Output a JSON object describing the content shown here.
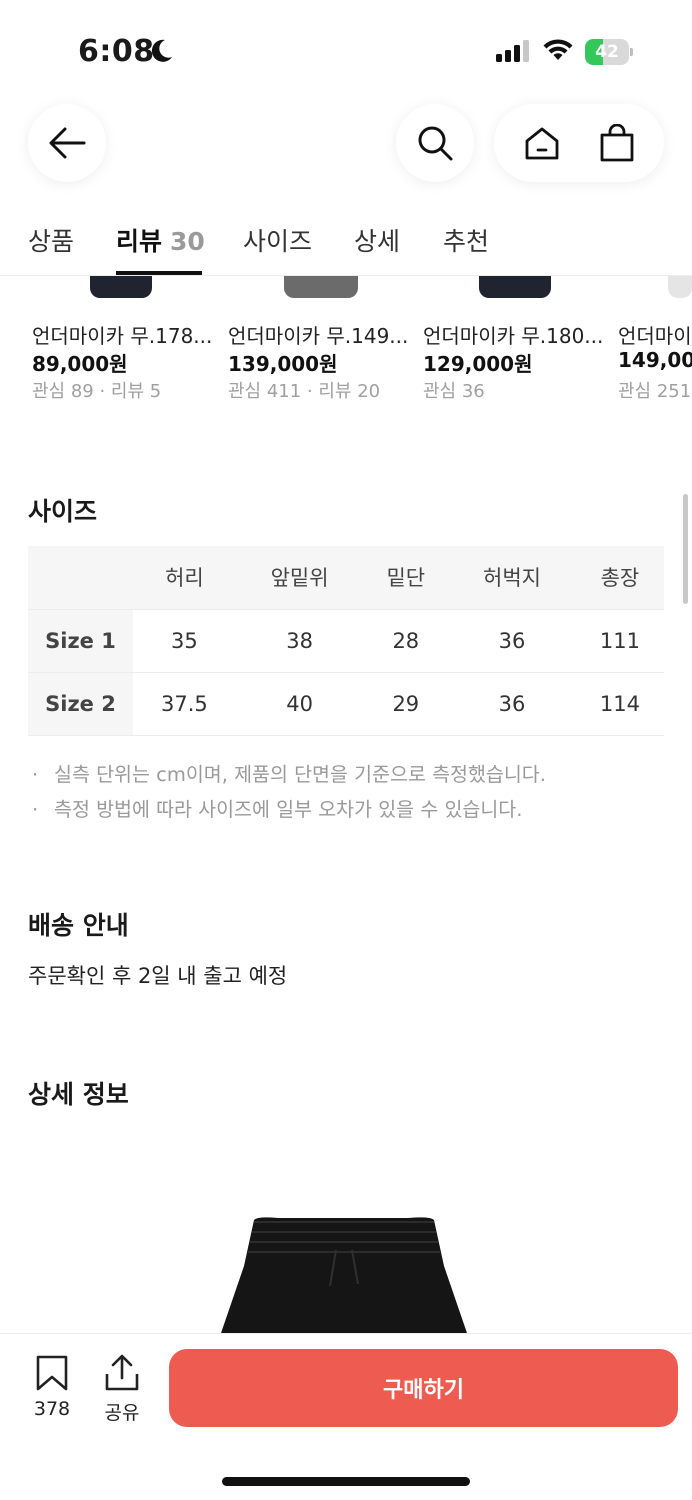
{
  "status_bar": {
    "time": "6:08",
    "battery": "42",
    "battery_level": 0.42
  },
  "tabs": [
    {
      "label": "상품"
    },
    {
      "label": "리뷰",
      "count": "30"
    },
    {
      "label": "사이즈"
    },
    {
      "label": "상세"
    },
    {
      "label": "추천"
    }
  ],
  "related_products": [
    {
      "name": "언더마이카 무.178...",
      "price": "89,000원",
      "meta": "관심 89 · 리뷰 5"
    },
    {
      "name": "언더마이카 무.149...",
      "price": "139,000원",
      "meta": "관심 411 · 리뷰 20"
    },
    {
      "name": "언더마이카 무.180...",
      "price": "129,000원",
      "meta": "관심 36"
    },
    {
      "name": "언더마이카",
      "price": "149,000",
      "meta": "관심 251"
    }
  ],
  "size_section": {
    "title": "사이즈",
    "headers": [
      "허리",
      "앞밑위",
      "밑단",
      "허벅지",
      "총장"
    ],
    "rows": [
      {
        "label": "Size 1",
        "values": [
          "35",
          "38",
          "28",
          "36",
          "111"
        ]
      },
      {
        "label": "Size 2",
        "values": [
          "37.5",
          "40",
          "29",
          "36",
          "114"
        ]
      }
    ],
    "notes": [
      "실측 단위는 cm이며, 제품의 단면을 기준으로 측정했습니다.",
      "측정 방법에 따라 사이즈에 일부 오차가 있을 수 있습니다."
    ],
    "bullet": "·"
  },
  "shipping": {
    "title": "배송 안내",
    "text": "주문확인 후 2일 내 출고 예정"
  },
  "detail": {
    "title": "상세 정보"
  },
  "bottom_bar": {
    "bookmark_count": "378",
    "share_label": "공유",
    "buy_label": "구매하기"
  },
  "colors": {
    "accent": "#ee5b50",
    "battery_green": "#34c759"
  }
}
